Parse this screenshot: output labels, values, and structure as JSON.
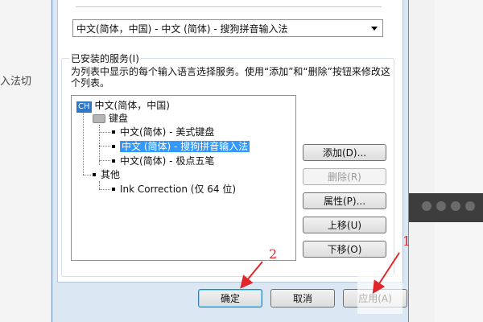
{
  "background": {
    "left_text": "入法切"
  },
  "dialog": {
    "combo_value": "中文(简体，中国) - 中文 (简体) - 搜狗拼音输入法",
    "group_title": "已安装的服务(I)",
    "description": "为列表中显示的每个输入语言选择服务。使用“添加”和“删除”按钮来修改这个列表。",
    "tree": {
      "root_badge": "CH",
      "root_label": "中文(简体，中国)",
      "keyboard_label": "键盘",
      "keyboard_items": [
        "中文(简体) - 美式键盘",
        "中文 (简体) - 搜狗拼音输入法",
        "中文(简体) - 极点五笔"
      ],
      "other_label": "其他",
      "other_items": [
        "Ink Correction (仅 64 位)"
      ]
    },
    "buttons": {
      "add": "添加(D)...",
      "remove": "删除(R)",
      "properties": "属性(P)...",
      "move_up": "上移(U)",
      "move_down": "下移(O)"
    },
    "footer": {
      "ok": "确定",
      "cancel": "取消",
      "apply": "应用(A)"
    }
  },
  "annotations": {
    "marker_1": "1",
    "marker_2": "2",
    "color": "#e2252b"
  }
}
